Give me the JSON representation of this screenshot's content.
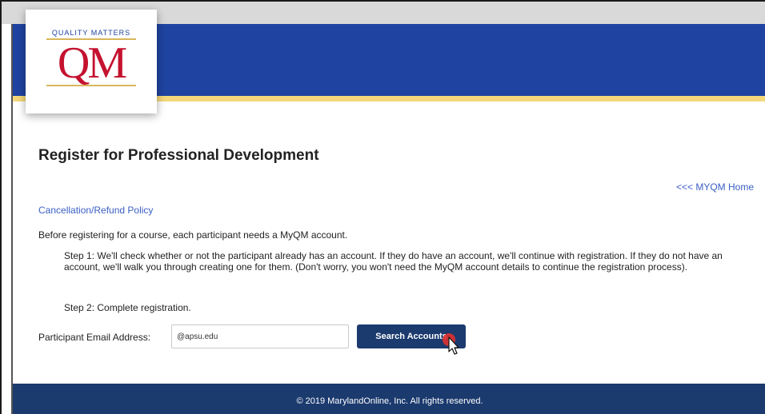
{
  "logo": {
    "tagline": "QUALITY MATTERS",
    "mark": "QM"
  },
  "page": {
    "title": "Register for Professional Development",
    "home_link": "<<< MYQM Home",
    "policy_link": "Cancellation/Refund Policy",
    "intro": "Before registering for a course, each participant needs a MyQM account.",
    "step1": "Step 1: We'll check whether or not the participant already has an account. If they do have an account, we'll continue with registration. If they do not have an account, we'll walk you through creating one for them. (Don't worry, you won't need the MyQM account details to continue the registration process).",
    "step2": "Step 2: Complete registration."
  },
  "form": {
    "email_label": "Participant Email Address:",
    "email_value": "@apsu.edu",
    "search_button": "Search Accounts"
  },
  "footer": {
    "copyright": "© 2019 MarylandOnline, Inc. All rights reserved."
  },
  "colors": {
    "banner": "#1f43a0",
    "gold": "#f4d77a",
    "brand_red": "#c4122f",
    "button": "#1b3a6e",
    "link": "#3a5fc4"
  }
}
